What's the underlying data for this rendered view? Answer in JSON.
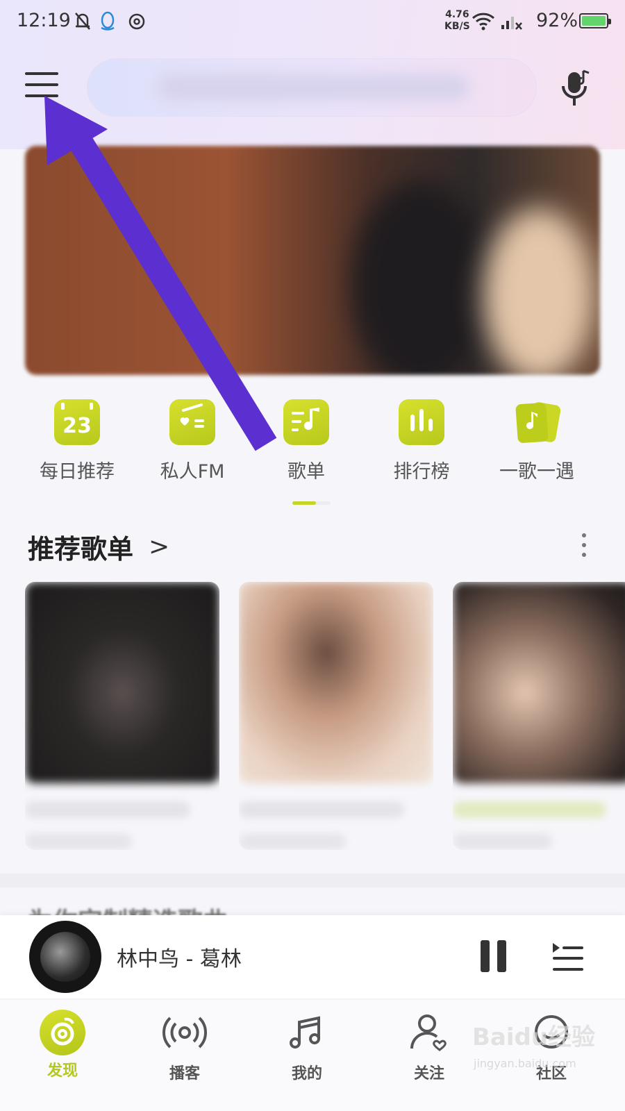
{
  "status_bar": {
    "time": "12:19",
    "net_speed_value": "4.76",
    "net_speed_unit": "KB/S",
    "battery": "92%"
  },
  "header": {
    "menu_icon": "hamburger-menu-icon",
    "search_placeholder": "",
    "voice_icon": "mic-music-icon"
  },
  "quick_nav": [
    {
      "label": "每日推荐",
      "icon": "calendar-icon",
      "badge": "23"
    },
    {
      "label": "私人FM",
      "icon": "radio-icon"
    },
    {
      "label": "歌单",
      "icon": "playlist-icon"
    },
    {
      "label": "排行榜",
      "icon": "chart-bars-icon"
    },
    {
      "label": "一歌一遇",
      "icon": "music-card-icon"
    }
  ],
  "recommend": {
    "title": "推荐歌单",
    "arrow": ">"
  },
  "section2": {
    "title": "为你定制精选歌曲"
  },
  "player": {
    "song": "林中鸟 - 葛林"
  },
  "tabs": [
    {
      "label": "发现",
      "icon": "discover-icon",
      "active": true
    },
    {
      "label": "播客",
      "icon": "podcast-icon"
    },
    {
      "label": "我的",
      "icon": "music-note-icon"
    },
    {
      "label": "关注",
      "icon": "follow-user-icon"
    },
    {
      "label": "社区",
      "icon": "community-icon"
    }
  ],
  "watermark": {
    "brand": "Baidu经验",
    "url": "jingyan.baidu.com"
  },
  "colors": {
    "accent": "#C6D52A",
    "annotation_arrow": "#5B2FD0"
  }
}
